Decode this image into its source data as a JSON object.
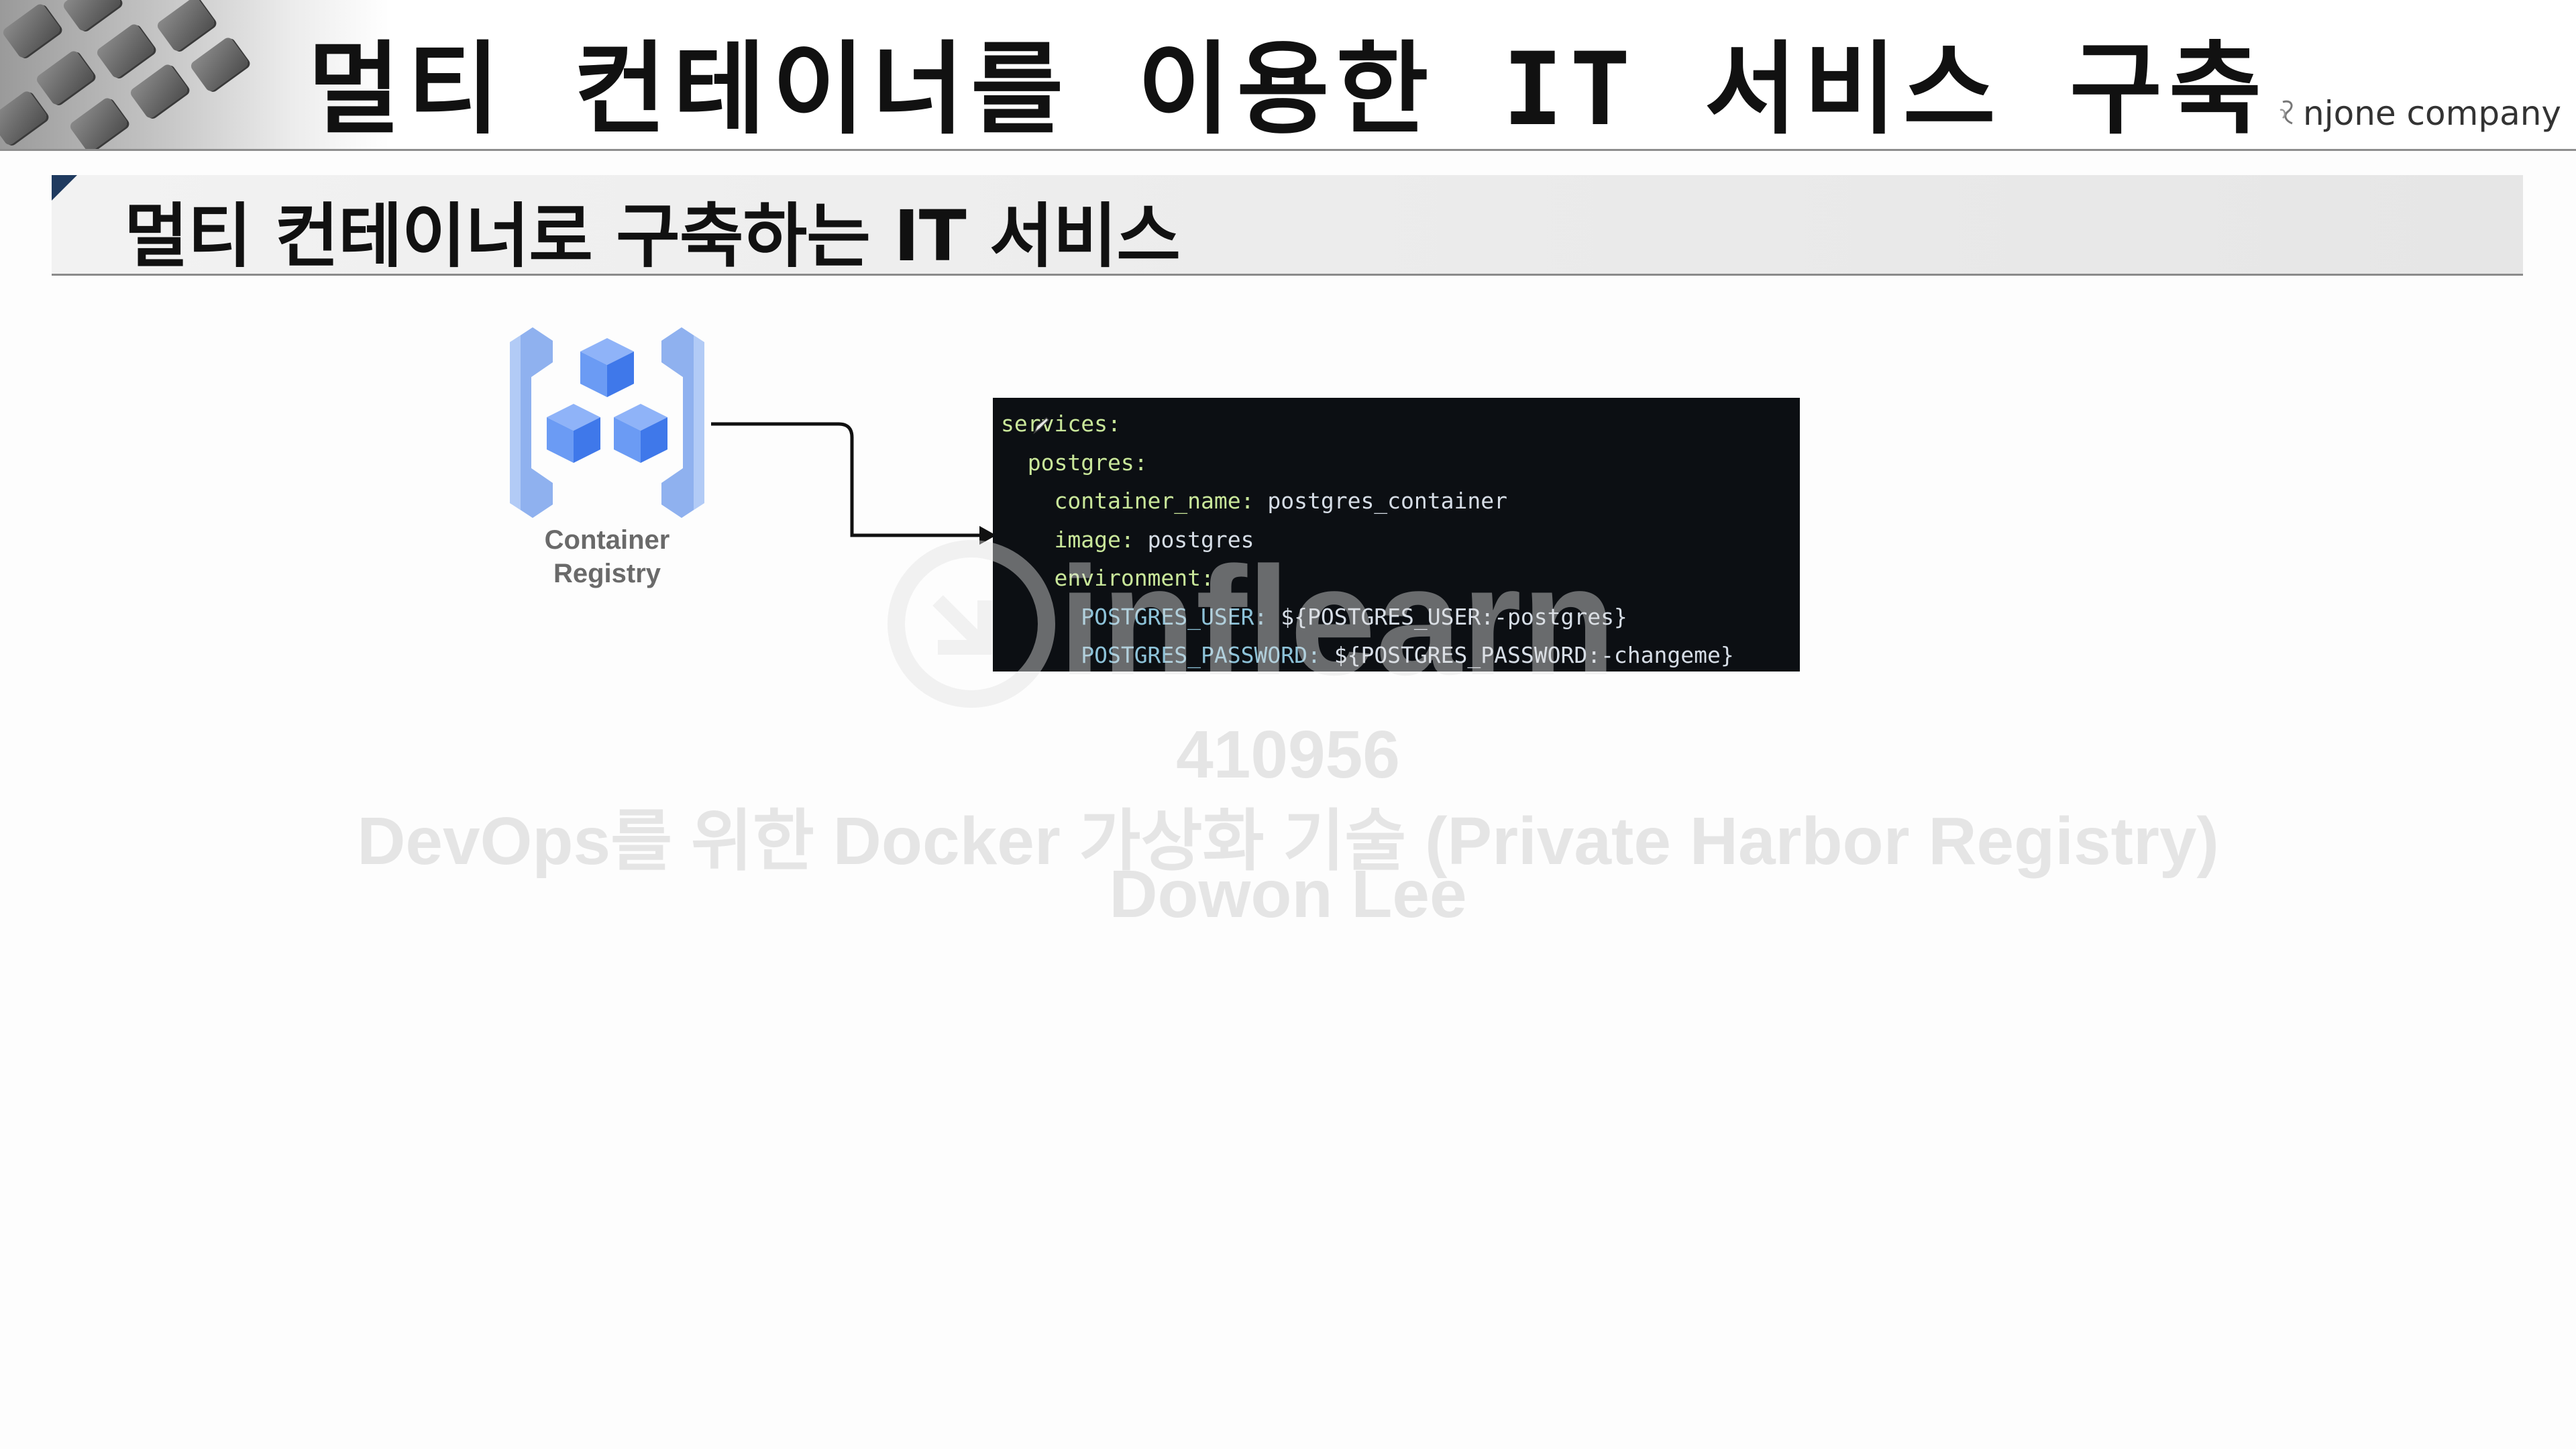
{
  "header": {
    "title": "멀티 컨테이너를 이용한 IT 서비스 구축",
    "brand": "njone company"
  },
  "section": {
    "title": "멀티 컨테이너로 구축하는 IT 서비스"
  },
  "registry": {
    "label_line1": "Container",
    "label_line2": "Registry",
    "icon_colors": {
      "bracket": "#a9c4f5",
      "cube_top": "#8fb3f8",
      "cube_side": "#4a84ef"
    }
  },
  "code": {
    "lines": [
      {
        "key": "services:",
        "value": ""
      },
      {
        "key": "postgres:",
        "value": ""
      },
      {
        "key": "container_name:",
        "value": " postgres_container"
      },
      {
        "key": "image:",
        "value": " postgres"
      },
      {
        "key": "environment:",
        "value": ""
      },
      {
        "key": "POSTGRES_USER:",
        "value": " ${POSTGRES_USER:-postgres}"
      },
      {
        "key": "POSTGRES_PASSWORD:",
        "value": " ${POSTGRES_PASSWORD:-changeme}"
      }
    ]
  },
  "watermark": {
    "logo_text": "inflearn",
    "id": "410956",
    "course": "DevOps를 위한 Docker 가상화 기술 (Private Harbor Registry)",
    "author": "Dowon Lee"
  }
}
